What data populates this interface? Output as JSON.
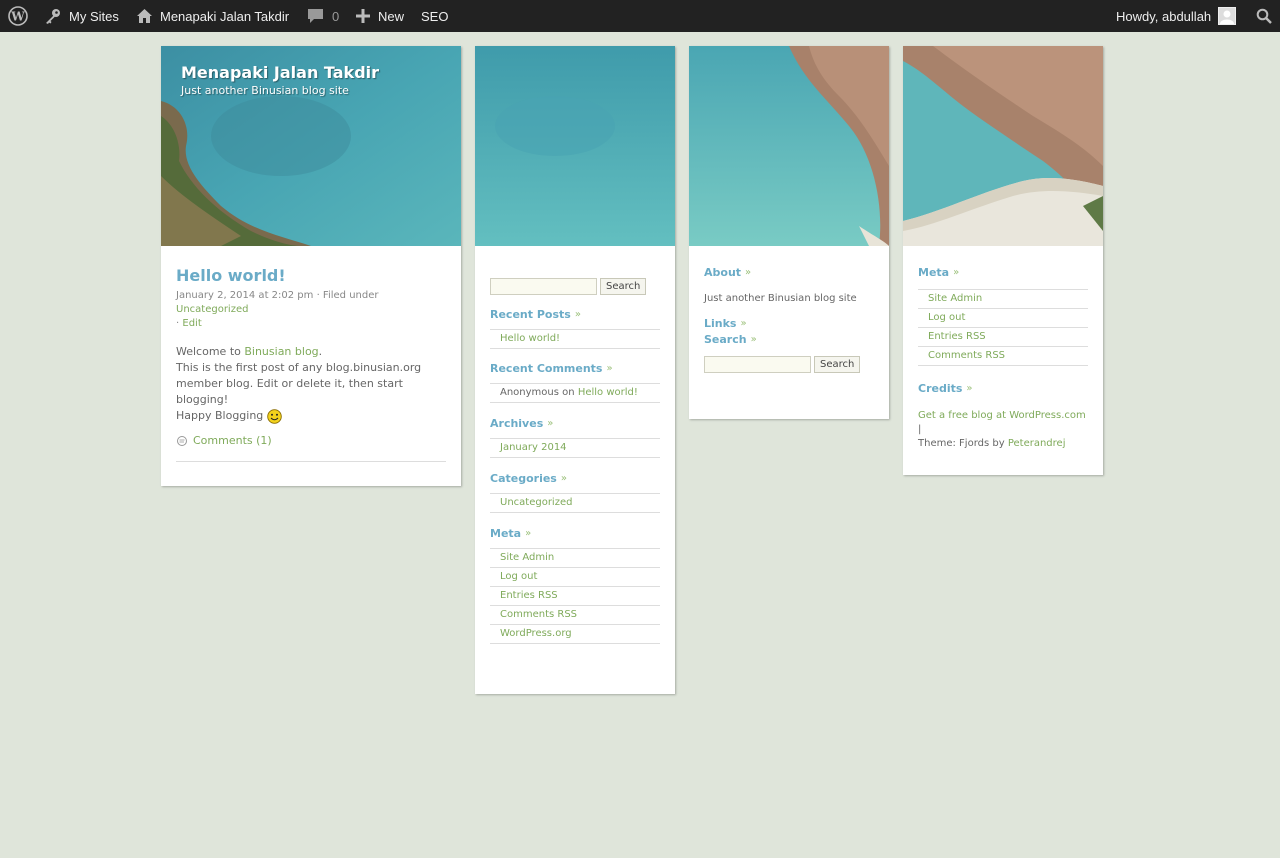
{
  "adminbar": {
    "my_sites": "My Sites",
    "site_name": "Menapaki Jalan Takdir",
    "comments_count": "0",
    "new_label": "New",
    "seo_label": "SEO",
    "howdy": "Howdy, abdullah"
  },
  "header": {
    "site_title": "Menapaki Jalan Takdir",
    "site_desc": "Just another Binusian blog site"
  },
  "post": {
    "title": "Hello world!",
    "date": "January 2, 2014 at 2:02 pm",
    "filed_under": "· Filed under",
    "category": "Uncategorized",
    "edit_sep": "·",
    "edit": "Edit",
    "welcome": "Welcome to",
    "welcome_link": "Binusian blog",
    "body_line": "This is the first post of any blog.binusian.org member blog. Edit or delete it, then start blogging!",
    "happy": "Happy Blogging",
    "comments": "Comments (1)"
  },
  "sidebar1": {
    "search_button": "Search",
    "recent_posts_title": "Recent Posts",
    "recent_posts": [
      "Hello world!"
    ],
    "recent_comments_title": "Recent Comments",
    "recent_comment_author": "Anonymous",
    "recent_comment_on": "on",
    "recent_comment_post": "Hello world!",
    "archives_title": "Archives",
    "archives": [
      "January 2014"
    ],
    "categories_title": "Categories",
    "categories": [
      "Uncategorized"
    ],
    "meta_title": "Meta",
    "meta": [
      "Site Admin",
      "Log out",
      "Entries RSS",
      "Comments RSS",
      "WordPress.org"
    ]
  },
  "sidebar2": {
    "about_title": "About",
    "about_text": "Just another Binusian blog site",
    "links_title": "Links",
    "search_title": "Search",
    "search_button": "Search"
  },
  "sidebar3": {
    "meta_title": "Meta",
    "meta": [
      "Site Admin",
      "Log out",
      "Entries RSS",
      "Comments RSS"
    ],
    "credits_title": "Credits",
    "credits_link": "Get a free blog at WordPress.com",
    "credits_sep": "|",
    "theme_text": "Theme: Fjords by",
    "theme_author": "Peterandrej"
  },
  "colors": {
    "adminbar_bg": "#222222",
    "page_bg": "#dfe5da",
    "title_blue": "#6aabc7",
    "link_green": "#7faa5a"
  },
  "icons": [
    "wordpress-icon",
    "key-icon",
    "home-icon",
    "comment-bubble-icon",
    "plus-icon",
    "avatar-icon",
    "search-icon",
    "comments-icon",
    "smiley-icon",
    "raquo-icon"
  ]
}
